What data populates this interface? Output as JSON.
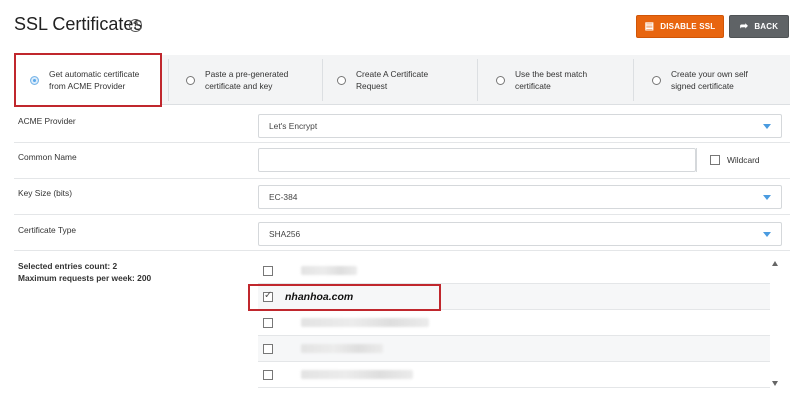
{
  "page": {
    "title": "SSL Certificates"
  },
  "header": {
    "disable_label": "DISABLE SSL",
    "back_label": "BACK"
  },
  "tabs": [
    {
      "line1": "Get automatic certificate",
      "line2": "from ACME Provider",
      "selected": true
    },
    {
      "line1": "Paste a pre-generated",
      "line2": "certificate and key",
      "selected": false
    },
    {
      "line1": "Create A Certificate",
      "line2": "Request",
      "selected": false
    },
    {
      "line1": "Use the best match",
      "line2": "certificate",
      "selected": false
    },
    {
      "line1": "Create your own self",
      "line2": "signed certificate",
      "selected": false
    }
  ],
  "form": {
    "acme_provider": {
      "label": "ACME Provider",
      "value": "Let's Encrypt"
    },
    "common_name": {
      "label": "Common Name",
      "value": "",
      "wildcard_label": "Wildcard",
      "wildcard_checked": false
    },
    "key_size": {
      "label": "Key Size (bits)",
      "value": "EC-384"
    },
    "certificate_type": {
      "label": "Certificate Type",
      "value": "SHA256"
    }
  },
  "entries": {
    "selected_count_text": "Selected entries count: 2",
    "max_requests_text": "Maximum requests per week: 200",
    "items": [
      {
        "name": "",
        "checked": false
      },
      {
        "name": "nhanhoa.com",
        "checked": true
      },
      {
        "name": "",
        "checked": false
      },
      {
        "name": "",
        "checked": false
      },
      {
        "name": "",
        "checked": false
      }
    ]
  },
  "colors": {
    "accent_orange": "#e8650f",
    "back_gray": "#5f6366",
    "highlight_red": "#c0272d",
    "radio_blue": "#59a8ea"
  }
}
